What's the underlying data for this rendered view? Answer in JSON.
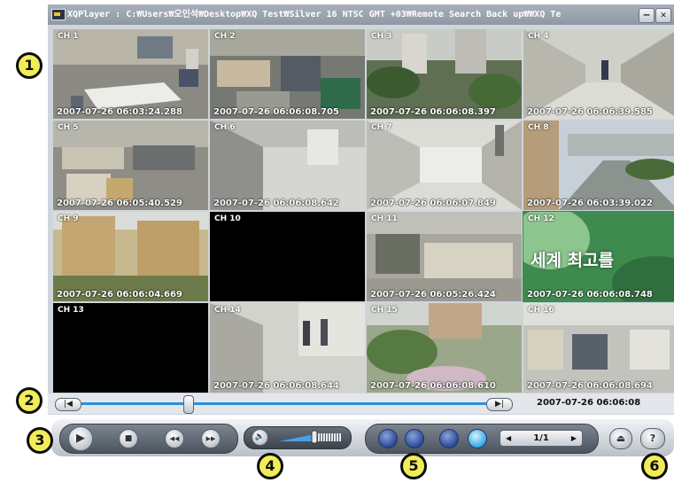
{
  "window": {
    "title": "XQPlayer : C:\\Users\\오인석\\Desktop\\XQ Test\\Silver 16 NTSC GMT +03\\Remote Search Back up\\\\XQ Te",
    "title_display": "XQPlayer : C:₩Users₩오인석₩Desktop₩XQ Test₩Silver 16 NTSC GMT +03₩Remote Search Back up₩₩XQ Te",
    "minimize_label": "–",
    "close_label": "✕"
  },
  "channels": [
    {
      "label": "CH 1",
      "timestamp": "2007-07-26 06:03:24.288"
    },
    {
      "label": "CH 2",
      "timestamp": "2007-07-26 06:06:08.705"
    },
    {
      "label": "CH 3",
      "timestamp": "2007-07-26 06:06:08.397"
    },
    {
      "label": "CH 4",
      "timestamp": "2007-07-26 06:06:39.585"
    },
    {
      "label": "CH 5",
      "timestamp": "2007-07-26 06:05:40.529"
    },
    {
      "label": "CH 6",
      "timestamp": "2007-07-26 06:06:08.642"
    },
    {
      "label": "CH 7",
      "timestamp": "2007-07-26 06:06:07.849"
    },
    {
      "label": "CH 8",
      "timestamp": "2007-07-26 06:03:39.022"
    },
    {
      "label": "CH 9",
      "timestamp": "2007-07-26 06:06:04.669"
    },
    {
      "label": "CH 10",
      "timestamp": ""
    },
    {
      "label": "CH 11",
      "timestamp": "2007-07-26 06:05:26.424"
    },
    {
      "label": "CH 12",
      "timestamp": "2007-07-26 06:06:08.748",
      "overlay": "세계 최고를"
    },
    {
      "label": "CH 13",
      "timestamp": ""
    },
    {
      "label": "CH 14",
      "timestamp": "2007-07-26 06:06:08.644"
    },
    {
      "label": "CH 15",
      "timestamp": "2007-07-26 06:06:08.610"
    },
    {
      "label": "CH 16",
      "timestamp": "2007-07-26 06:06:08.694"
    }
  ],
  "timeline": {
    "start_icon": "skip-start-icon",
    "end_icon": "skip-end-icon",
    "start_glyph": "|◀",
    "end_glyph": "▶|",
    "current_time": "2007-07-26 06:06:08",
    "position": 0.26
  },
  "controls": {
    "play_glyph": "▶",
    "stop_glyph": "■",
    "rewind_glyph": "◀◀",
    "forward_glyph": "▶▶",
    "volume_glyph": "🔈",
    "volume_level": 0.55,
    "page": "1/1",
    "page_prev": "◀",
    "page_next": "▶",
    "eject_glyph": "⏏",
    "help_glyph": "?"
  },
  "callouts": [
    "1",
    "2",
    "3",
    "4",
    "5",
    "6"
  ],
  "colors": {
    "accent": "#2c8fd8",
    "callout": "#f2ec57"
  }
}
